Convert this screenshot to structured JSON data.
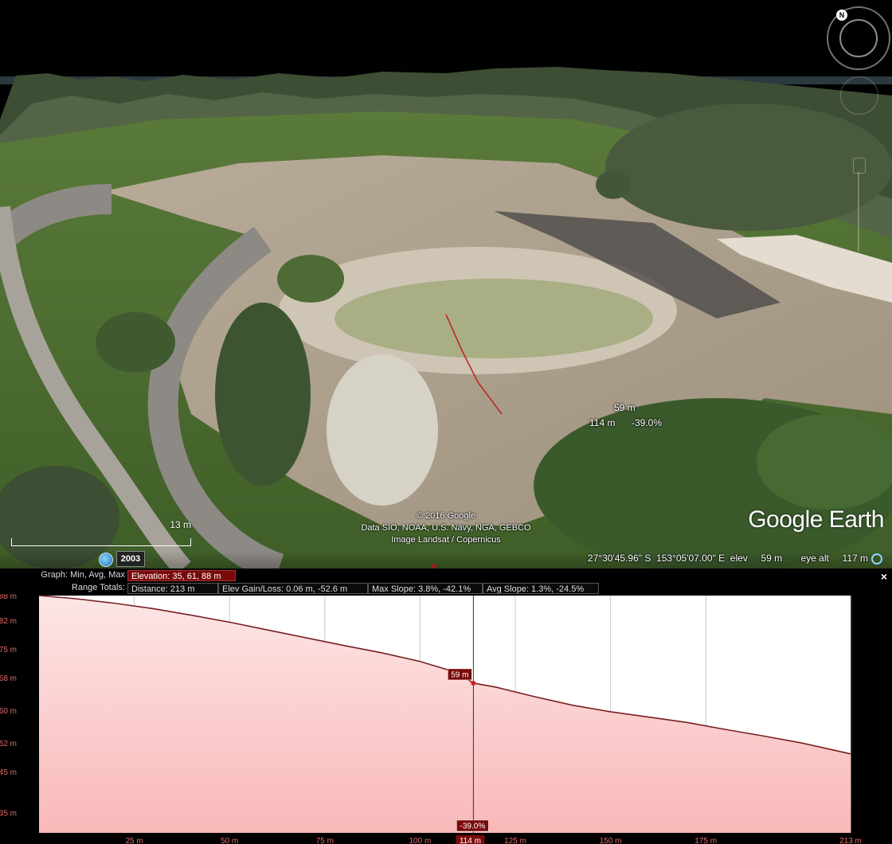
{
  "map_view": {
    "cursor": {
      "elevation": "59 m",
      "distance": "114 m",
      "slope": "-39.0%"
    },
    "attribution": [
      "© 2016 Google",
      "Data SIO, NOAA, U.S. Navy, NGA, GEBCO",
      "Image Landsat / Copernicus"
    ],
    "logo": "Google Earth",
    "scale_label": "13 m",
    "historical_year": "2003",
    "status": {
      "lat": "27°30'45.96\" S",
      "lon": "153°05'07.00\" E",
      "elev_label": "elev",
      "elev": "59 m",
      "eye_alt_label": "eye alt",
      "eye_alt": "117 m"
    },
    "compass_letter": "N"
  },
  "profile": {
    "graph_label": "Graph: Min, Avg, Max",
    "graph_value": "Elevation: 35, 61, 88 m",
    "range_label": "Range Totals:",
    "distance": "Distance: 213 m",
    "elev_gain_loss": "Elev Gain/Loss: 0.06 m, -52.6 m",
    "max_slope": "Max Slope: 3.8%, -42.1%",
    "avg_slope": "Avg Slope: 1.3%, -24.5%",
    "close": "×"
  },
  "chart_data": {
    "type": "area",
    "title": "",
    "xlabel": "",
    "ylabel": "",
    "xlim": [
      0,
      213
    ],
    "ylim": [
      30,
      88
    ],
    "x_ticks": [
      25,
      50,
      75,
      100,
      125,
      150,
      175,
      213
    ],
    "x_tick_labels": [
      "25 m",
      "50 m",
      "75 m",
      "100 m",
      "125 m",
      "150 m",
      "175 m",
      "213 m"
    ],
    "y_ticks": [
      88,
      82,
      75,
      68,
      60,
      52,
      45,
      35
    ],
    "y_tick_labels": [
      "88 m",
      "82 m",
      "75 m",
      "68 m",
      "60 m",
      "52 m",
      "45 m",
      "35 m"
    ],
    "grid": true,
    "series": [
      {
        "x": [
          0,
          10,
          20,
          30,
          40,
          50,
          60,
          70,
          80,
          90,
          100,
          110,
          114,
          120,
          130,
          140,
          150,
          160,
          170,
          180,
          190,
          200,
          213
        ],
        "values": [
          88,
          87.2,
          86.1,
          84.8,
          83.2,
          81.5,
          79.6,
          77.7,
          75.8,
          74.0,
          71.9,
          69.1,
          66.6,
          65.6,
          63.3,
          61.2,
          59.6,
          58.3,
          57.0,
          55.3,
          53.7,
          52.0,
          49.3
        ]
      }
    ],
    "cursor": {
      "x": 114,
      "x_label": "114 m",
      "y_label": "59 m",
      "slope_label": "-39.0%"
    },
    "colors": {
      "line": "#7a1f1f",
      "fill_top": "#fde6e6",
      "fill_bottom": "#f9b8b8",
      "grid": "#c8c8c8",
      "cursor": "#333333"
    }
  }
}
